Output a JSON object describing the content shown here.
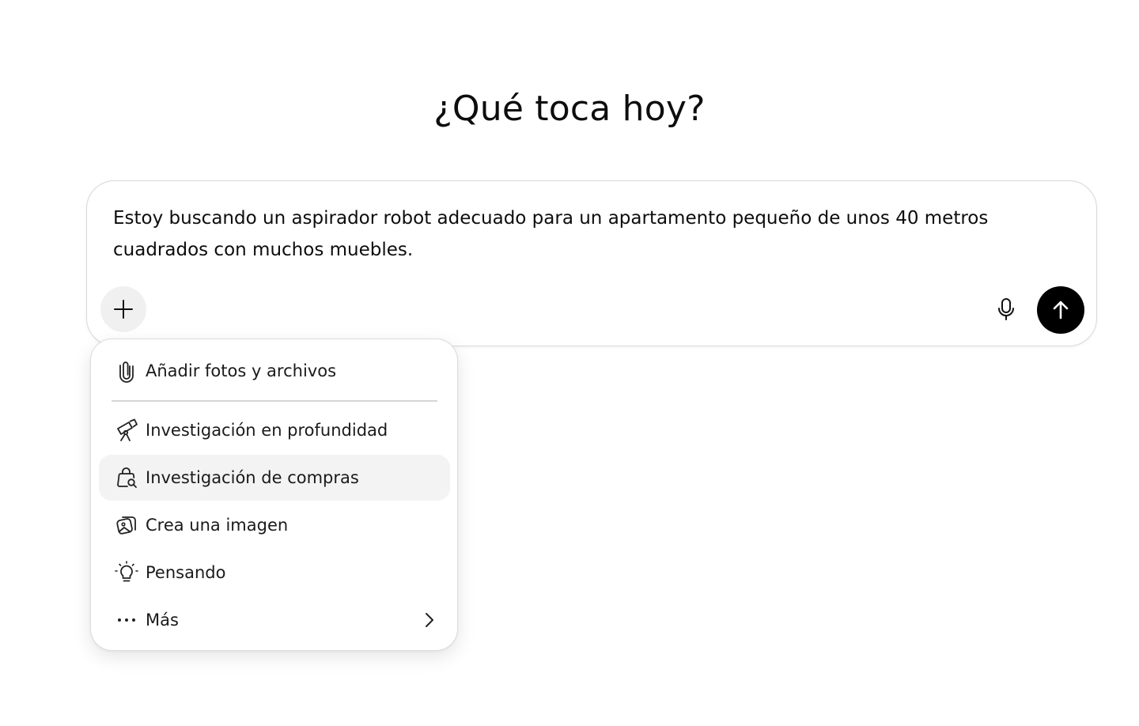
{
  "heading": "¿Qué toca hoy?",
  "composer": {
    "text": "Estoy buscando un aspirador robot adecuado para un apartamento pequeño de unos 40 metros cuadrados con muchos muebles."
  },
  "menu": {
    "items": [
      {
        "label": "Añadir fotos y archivos",
        "icon": "paperclip-icon"
      },
      {
        "label": "Investigación en profundidad",
        "icon": "telescope-icon"
      },
      {
        "label": "Investigación de compras",
        "icon": "shopping-bag-search-icon",
        "highlighted": true
      },
      {
        "label": "Crea una imagen",
        "icon": "image-create-icon"
      },
      {
        "label": "Pensando",
        "icon": "lightbulb-icon"
      },
      {
        "label": "Más",
        "icon": "more-dots-icon",
        "submenu": true
      }
    ]
  },
  "colors": {
    "send_button": "#000000",
    "plus_button_bg": "#f0f0f0",
    "highlight_bg": "#f3f3f3"
  }
}
